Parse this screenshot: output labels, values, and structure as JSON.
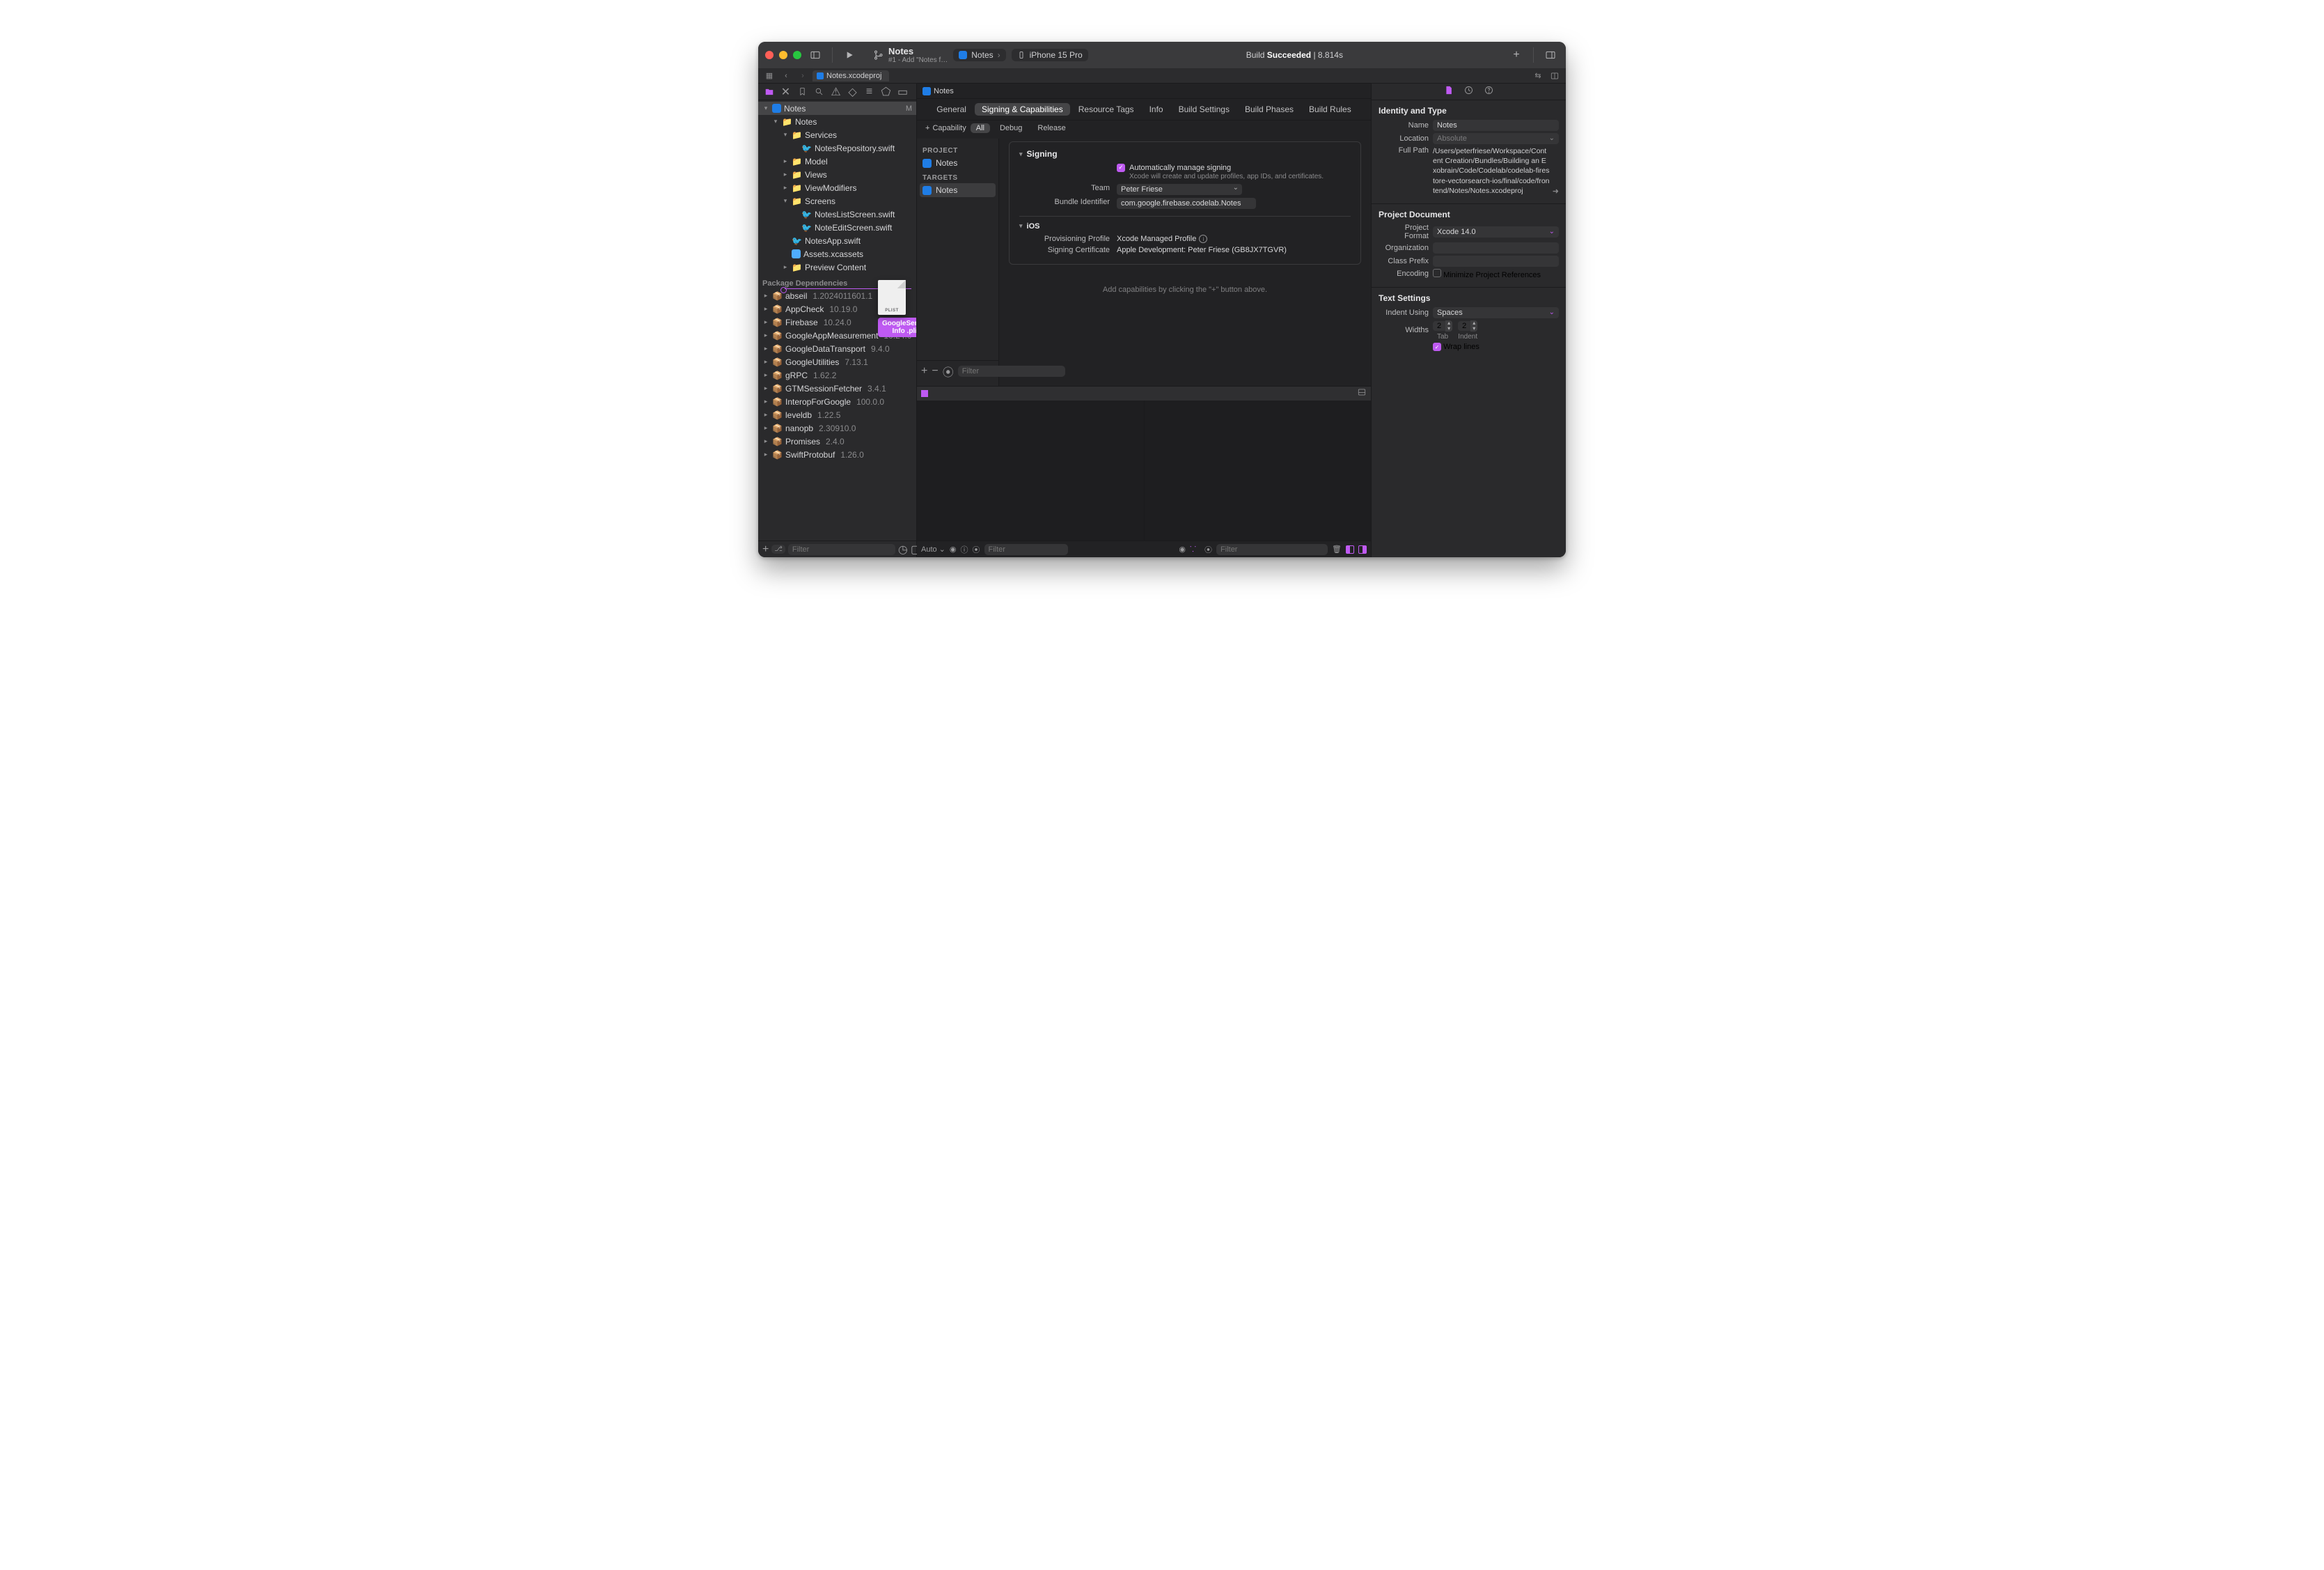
{
  "titlebar": {
    "scheme_title": "Notes",
    "scheme_subtitle": "#1 - Add \"Notes f…",
    "scheme_target": "Notes",
    "device": "iPhone 15 Pro",
    "status_prefix": "Build",
    "status_bold": "Succeeded",
    "status_time": "| 8.814s"
  },
  "tabstrip": {
    "tab": "Notes.xcodeproj"
  },
  "navigator": {
    "root": "Notes",
    "root_status": "M",
    "tree": {
      "notes_folder": "Notes",
      "services": "Services",
      "notes_repo": "NotesRepository.swift",
      "model": "Model",
      "views": "Views",
      "view_modifiers": "ViewModifiers",
      "screens": "Screens",
      "notes_list": "NotesListScreen.swift",
      "note_edit": "NoteEditScreen.swift",
      "notes_app": "NotesApp.swift",
      "assets": "Assets.xcassets",
      "preview": "Preview Content"
    },
    "pkg_header": "Package Dependencies",
    "packages": [
      {
        "name": "abseil",
        "ver": "1.2024011601.1"
      },
      {
        "name": "AppCheck",
        "ver": "10.19.0"
      },
      {
        "name": "Firebase",
        "ver": "10.24.0"
      },
      {
        "name": "GoogleAppMeasurement",
        "ver": "10.24.0"
      },
      {
        "name": "GoogleDataTransport",
        "ver": "9.4.0"
      },
      {
        "name": "GoogleUtilities",
        "ver": "7.13.1"
      },
      {
        "name": "gRPC",
        "ver": "1.62.2"
      },
      {
        "name": "GTMSessionFetcher",
        "ver": "3.4.1"
      },
      {
        "name": "InteropForGoogle",
        "ver": "100.0.0"
      },
      {
        "name": "leveldb",
        "ver": "1.22.5"
      },
      {
        "name": "nanopb",
        "ver": "2.30910.0"
      },
      {
        "name": "Promises",
        "ver": "2.4.0"
      },
      {
        "name": "SwiftProtobuf",
        "ver": "1.26.0"
      }
    ],
    "filter_placeholder": "Filter",
    "drag": {
      "paper_label": "PLIST",
      "name": "GoogleService-Info .plist"
    }
  },
  "crumb": {
    "project": "Notes"
  },
  "target_list": {
    "project_head": "PROJECT",
    "project_item": "Notes",
    "targets_head": "TARGETS",
    "target_item": "Notes",
    "filter_placeholder": "Filter"
  },
  "editor_tabs": [
    "General",
    "Signing & Capabilities",
    "Resource Tags",
    "Info",
    "Build Settings",
    "Build Phases",
    "Build Rules"
  ],
  "caprow": {
    "add": "Capability",
    "all": "All",
    "debug": "Debug",
    "release": "Release"
  },
  "signing": {
    "header": "Signing",
    "auto_label": "Automatically manage signing",
    "auto_sub": "Xcode will create and update profiles, app IDs, and certificates.",
    "team_k": "Team",
    "team_v": "Peter Friese",
    "bundle_k": "Bundle Identifier",
    "bundle_v": "com.google.firebase.codelab.Notes",
    "ios_header": "iOS",
    "prov_k": "Provisioning Profile",
    "prov_v": "Xcode Managed Profile",
    "cert_k": "Signing Certificate",
    "cert_v": "Apple Development: Peter Friese (GB8JX7TGVR)"
  },
  "hint": "Add capabilities by clicking the \"+\" button above.",
  "botfoot": {
    "auto": "Auto ⌄",
    "filter_placeholder": "Filter"
  },
  "inspector": {
    "identity_h": "Identity and Type",
    "name_k": "Name",
    "name_v": "Notes",
    "location_k": "Location",
    "location_v": "Absolute",
    "fullpath_k": "Full Path",
    "fullpath_v": "/Users/peterfriese/Workspace/Content Creation/Bundles/Building an Exobrain/Code/Codelab/codelab-firestore-vectorsearch-ios/final/code/frontend/Notes/Notes.xcodeproj",
    "projdoc_h": "Project Document",
    "format_k": "Project Format",
    "format_v": "Xcode 14.0",
    "org_k": "Organization",
    "prefix_k": "Class Prefix",
    "encoding_k": "Encoding",
    "encoding_v": "Minimize Project References",
    "text_h": "Text Settings",
    "indent_k": "Indent Using",
    "indent_v": "Spaces",
    "widths_k": "Widths",
    "tab_n": "2",
    "tab_l": "Tab",
    "indent_n": "2",
    "indent_l": "Indent",
    "wrap": "Wrap lines"
  }
}
